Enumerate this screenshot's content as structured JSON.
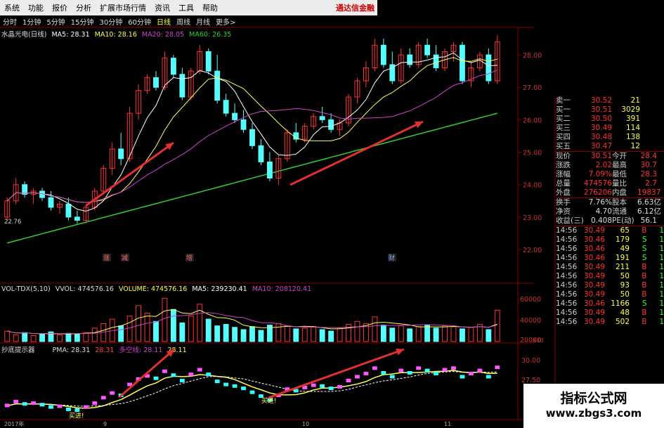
{
  "menu": {
    "items": [
      "系统",
      "功能",
      "报价",
      "分析",
      "扩展市场行情",
      "资讯",
      "工具",
      "帮助"
    ],
    "broker": "通达信金融"
  },
  "periods": {
    "items": [
      "分时",
      "1分钟",
      "5分钟",
      "15分钟",
      "30分钟",
      "60分钟",
      "日线",
      "周线",
      "月线",
      "更多>"
    ],
    "active": "日线"
  },
  "main_chart": {
    "title": "水晶光电(日线)",
    "ma5": "MA5: 28.31",
    "ma10": "MA10: 28.16",
    "ma20": "MA20: 28.05",
    "ma60": "MA60: 26.35",
    "y_ticks": [
      "28.00",
      "27.00",
      "26.00",
      "25.00",
      "24.00",
      "23.00",
      "22.00"
    ],
    "low_label": "22.76",
    "badges": [
      "涨",
      "减",
      "增",
      "财"
    ]
  },
  "volume_chart": {
    "label": "VOL-TDX(5,10)",
    "vvol": "VVOL: 474576.16",
    "volume": "VOLUME: 474576.16",
    "ma5": "MA5: 239230.41",
    "ma10": "MA10: 208120.41",
    "y_ticks": [
      "60000",
      "40000",
      "20000"
    ],
    "unit": "X10"
  },
  "signal_chart": {
    "label": "抄底提示器",
    "pma": "PMA: 28.31",
    "val1": "28.31",
    "multi_empty": "多空线: 28.11",
    "val2": "28.11",
    "y_ticks": [
      "30.00",
      "27.50"
    ],
    "buy_labels": [
      "买进!",
      "买进!"
    ],
    "x_labels": [
      "2017年",
      "9",
      "10",
      "11"
    ]
  },
  "quote_panel": {
    "bids_asks": [
      {
        "label": "卖一",
        "price": "30.52",
        "vol": "21"
      },
      {
        "label": "买一",
        "price": "30.51",
        "vol": "3029"
      },
      {
        "label": "买二",
        "price": "30.50",
        "vol": "391"
      },
      {
        "label": "买三",
        "price": "30.49",
        "vol": "114"
      },
      {
        "label": "买四",
        "price": "30.48",
        "vol": "138"
      },
      {
        "label": "买五",
        "price": "30.47",
        "vol": "12"
      }
    ],
    "stats": [
      {
        "l1": "现价",
        "v1": "30.51",
        "l2": "今开",
        "v2": "28.4"
      },
      {
        "l1": "涨跌",
        "v1": "2.02",
        "l2": "最高",
        "v2": "30.7"
      },
      {
        "l1": "涨幅",
        "v1": "7.09%",
        "l2": "最低",
        "v2": "28.3"
      },
      {
        "l1": "总量",
        "v1": "474576",
        "l2": "量比",
        "v2": "2.7"
      },
      {
        "l1": "外盘",
        "v1": "276206",
        "l2": "内盘",
        "v2": "19837"
      }
    ],
    "finance": [
      {
        "l1": "换手",
        "v1": "7.76%",
        "l2": "股本",
        "v2": "6.63亿"
      },
      {
        "l1": "净资",
        "v1": "4.70",
        "l2": "流通",
        "v2": "6.12亿"
      },
      {
        "l1": "收益(三)",
        "v1": "0.408",
        "l2": "PE(动)",
        "v2": "56.1"
      }
    ],
    "ticks": [
      {
        "t": "14:56",
        "p": "30.49",
        "v": "65",
        "s": "B",
        "n": "1"
      },
      {
        "t": "14:56",
        "p": "30.46",
        "v": "179",
        "s": "S",
        "n": "1"
      },
      {
        "t": "14:56",
        "p": "30.46",
        "v": "49",
        "s": "S",
        "n": "1"
      },
      {
        "t": "14:56",
        "p": "30.46",
        "v": "191",
        "s": "S",
        "n": "1"
      },
      {
        "t": "14:56",
        "p": "30.49",
        "v": "211",
        "s": "B",
        "n": "1"
      },
      {
        "t": "14:56",
        "p": "30.49",
        "v": "50",
        "s": "B",
        "n": "1"
      },
      {
        "t": "14:56",
        "p": "30.49",
        "v": "93",
        "s": "B",
        "n": "1"
      },
      {
        "t": "14:56",
        "p": "30.49",
        "v": "50",
        "s": "B",
        "n": "1"
      },
      {
        "t": "14:56",
        "p": "30.46",
        "v": "1166",
        "s": "S",
        "n": "1"
      },
      {
        "t": "14:56",
        "p": "30.49",
        "v": "48",
        "s": "B",
        "n": "1"
      },
      {
        "t": "14:56",
        "p": "30.49",
        "v": "502",
        "s": "B",
        "n": "1"
      }
    ]
  },
  "watermark": {
    "title": "指标公式网",
    "url": "www.zbgs3.com"
  },
  "colors": {
    "up": "#ff3333",
    "down": "#55ffff",
    "ma5": "#ffffff",
    "ma10": "#ffff55",
    "ma20": "#cc44cc",
    "ma60": "#33cc33",
    "arrow": "#e03030",
    "grid": "#880000"
  },
  "chart_data": {
    "type": "candlestick",
    "title": "水晶光电(日线)",
    "ylim": [
      22.0,
      28.5
    ],
    "ohlc": [
      [
        23.0,
        23.6,
        22.9,
        23.5
      ],
      [
        23.5,
        24.2,
        23.4,
        24.0
      ],
      [
        24.0,
        24.1,
        23.6,
        23.7
      ],
      [
        23.7,
        23.9,
        23.4,
        23.8
      ],
      [
        23.8,
        23.9,
        23.5,
        23.6
      ],
      [
        23.6,
        23.8,
        23.2,
        23.3
      ],
      [
        23.3,
        23.5,
        23.1,
        23.4
      ],
      [
        23.4,
        23.6,
        22.9,
        23.0
      ],
      [
        23.0,
        23.2,
        22.8,
        22.9
      ],
      [
        22.9,
        23.4,
        22.8,
        23.3
      ],
      [
        23.3,
        23.9,
        23.2,
        23.8
      ],
      [
        23.8,
        24.6,
        23.7,
        24.5
      ],
      [
        24.5,
        25.3,
        24.3,
        25.1
      ],
      [
        25.1,
        25.6,
        24.6,
        24.8
      ],
      [
        24.8,
        26.4,
        24.7,
        26.2
      ],
      [
        26.2,
        27.1,
        26.0,
        26.9
      ],
      [
        26.9,
        27.4,
        26.8,
        27.3
      ],
      [
        27.3,
        27.5,
        26.9,
        27.0
      ],
      [
        27.0,
        28.1,
        26.9,
        27.9
      ],
      [
        27.9,
        28.0,
        27.3,
        27.4
      ],
      [
        27.4,
        27.6,
        26.6,
        26.7
      ],
      [
        26.7,
        27.6,
        26.6,
        27.5
      ],
      [
        27.5,
        28.3,
        27.4,
        28.1
      ],
      [
        28.1,
        28.2,
        27.4,
        27.5
      ],
      [
        27.5,
        28.0,
        26.5,
        26.6
      ],
      [
        26.6,
        26.8,
        26.1,
        26.2
      ],
      [
        26.2,
        26.5,
        25.9,
        26.0
      ],
      [
        26.0,
        26.3,
        25.6,
        25.7
      ],
      [
        25.7,
        25.9,
        25.1,
        25.2
      ],
      [
        25.2,
        25.4,
        24.6,
        24.7
      ],
      [
        24.7,
        25.0,
        24.1,
        24.2
      ],
      [
        24.2,
        24.9,
        24.0,
        24.8
      ],
      [
        24.8,
        25.7,
        24.7,
        25.6
      ],
      [
        25.6,
        25.9,
        25.3,
        25.4
      ],
      [
        25.4,
        25.9,
        25.3,
        25.8
      ],
      [
        25.8,
        26.2,
        25.7,
        26.1
      ],
      [
        26.1,
        26.4,
        25.9,
        26.0
      ],
      [
        26.0,
        26.2,
        25.6,
        25.7
      ],
      [
        25.7,
        26.0,
        25.5,
        25.9
      ],
      [
        25.9,
        26.8,
        25.8,
        26.7
      ],
      [
        26.7,
        27.3,
        26.5,
        27.2
      ],
      [
        27.2,
        27.8,
        27.0,
        27.6
      ],
      [
        27.6,
        28.5,
        27.5,
        28.3
      ],
      [
        28.3,
        28.5,
        27.6,
        27.7
      ],
      [
        27.7,
        28.1,
        27.1,
        27.2
      ],
      [
        27.2,
        28.2,
        27.1,
        28.0
      ],
      [
        28.0,
        28.2,
        27.6,
        27.7
      ],
      [
        27.7,
        28.4,
        27.6,
        28.3
      ],
      [
        28.3,
        28.5,
        27.9,
        28.0
      ],
      [
        28.0,
        28.3,
        27.5,
        27.6
      ],
      [
        27.6,
        28.2,
        27.5,
        28.1
      ],
      [
        28.1,
        28.4,
        27.8,
        28.3
      ],
      [
        28.3,
        28.4,
        27.1,
        27.2
      ],
      [
        27.2,
        27.8,
        27.0,
        27.6
      ],
      [
        27.6,
        28.1,
        27.5,
        28.0
      ],
      [
        28.0,
        28.2,
        27.1,
        27.2
      ],
      [
        27.2,
        28.6,
        27.1,
        28.4
      ]
    ],
    "volumes": [
      14,
      9,
      12,
      8,
      10,
      13,
      9,
      11,
      10,
      12,
      18,
      24,
      30,
      21,
      34,
      48,
      38,
      27,
      58,
      43,
      25,
      34,
      50,
      30,
      21,
      23,
      19,
      16,
      20,
      15,
      22,
      24,
      21,
      17,
      18,
      20,
      16,
      14,
      18,
      23,
      27,
      24,
      33,
      22,
      18,
      21,
      17,
      20,
      22,
      18,
      21,
      20,
      17,
      19,
      23,
      16,
      42
    ],
    "series": [
      {
        "name": "MA5",
        "color": "#ffffff"
      },
      {
        "name": "MA10",
        "color": "#ffff55"
      },
      {
        "name": "MA20",
        "color": "#cc44cc"
      },
      {
        "name": "MA60",
        "color": "#33cc33"
      }
    ]
  }
}
